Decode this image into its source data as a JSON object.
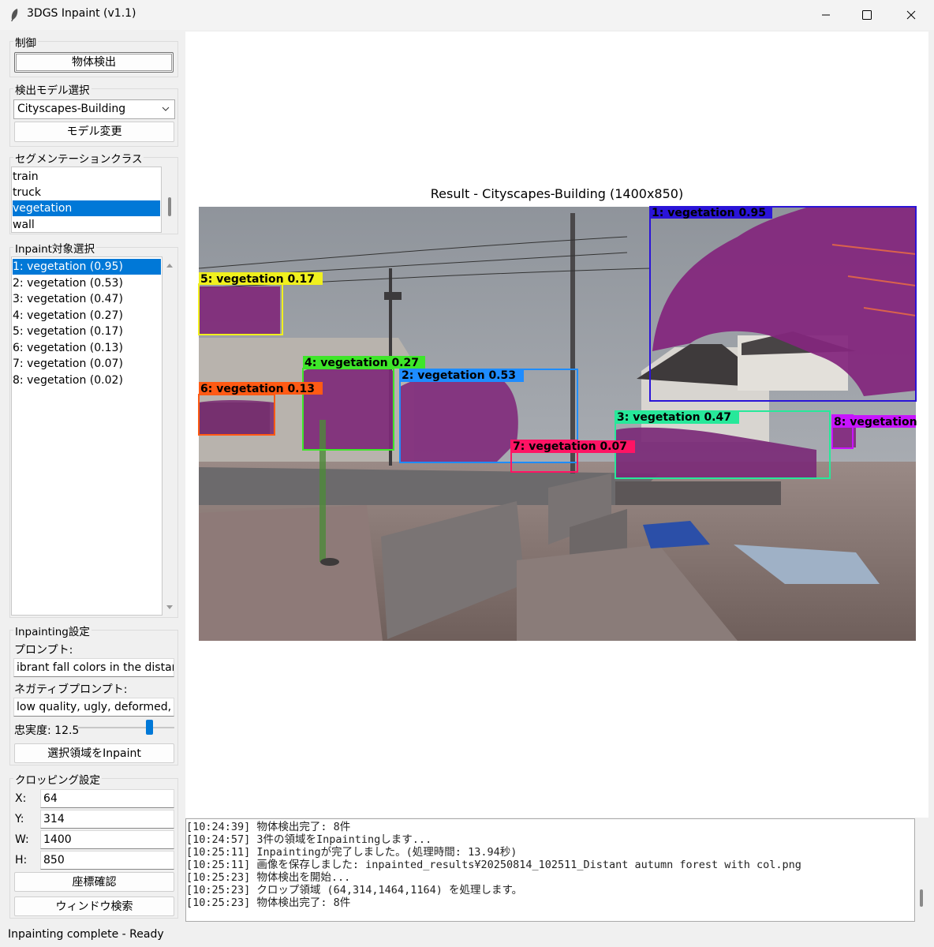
{
  "window": {
    "title": "3DGS Inpaint (v1.1)"
  },
  "control": {
    "group_label": "制御",
    "detect_button": "物体検出"
  },
  "model": {
    "group_label": "検出モデル選択",
    "selected": "Cityscapes-Building",
    "change_button": "モデル変更"
  },
  "segmentation": {
    "group_label": "セグメンテーションクラス",
    "items": [
      "train",
      "truck",
      "vegetation",
      "wall"
    ],
    "selected_index": 2
  },
  "targets": {
    "group_label": "Inpaint対象選択",
    "items": [
      "1: vegetation (0.95)",
      "2: vegetation (0.53)",
      "3: vegetation (0.47)",
      "4: vegetation (0.27)",
      "5: vegetation (0.17)",
      "6: vegetation (0.13)",
      "7: vegetation (0.07)",
      "8: vegetation (0.02)"
    ],
    "selected_index": 0
  },
  "inpainting": {
    "group_label": "Inpainting設定",
    "prompt_label": "プロンプト:",
    "prompt_value": "ibrant fall colors in the distance",
    "negative_label": "ネガティブプロンプト:",
    "negative_value": "low quality, ugly, deformed, text",
    "guidance_label": "忠実度: 12.5",
    "guidance_fraction": 0.74,
    "inpaint_button": "選択領域をInpaint"
  },
  "cropping": {
    "group_label": "クロッピング設定",
    "x_label": "X:",
    "x_value": "64",
    "y_label": "Y:",
    "y_value": "314",
    "w_label": "W:",
    "w_value": "1400",
    "h_label": "H:",
    "h_value": "850",
    "confirm_button": "座標確認",
    "window_search_button": "ウィンドウ検索"
  },
  "result": {
    "title": "Result - Cityscapes-Building (1400x850)",
    "detections": [
      {
        "label": "1: vegetation 0.95",
        "color": "#2a14d8"
      },
      {
        "label": "2: vegetation 0.53",
        "color": "#1e8cff"
      },
      {
        "label": "3: vegetation 0.47",
        "color": "#27e89a"
      },
      {
        "label": "4: vegetation 0.27",
        "color": "#3ee62a"
      },
      {
        "label": "5: vegetation 0.17",
        "color": "#f0f01e"
      },
      {
        "label": "6: vegetation 0.13",
        "color": "#ff5a14"
      },
      {
        "label": "7: vegetation 0.07",
        "color": "#ff1464"
      },
      {
        "label": "8: vegetation",
        "color": "#c814ff"
      }
    ]
  },
  "log": [
    "[10:24:39] 物体検出完了: 8件",
    "[10:24:57] 3件の領域をInpaintingします...",
    "[10:25:11] Inpaintingが完了しました。(処理時間: 13.94秒)",
    "[10:25:11] 画像を保存しました: inpainted_results¥20250814_102511_Distant autumn forest with col.png",
    "[10:25:23] 物体検出を開始...",
    "[10:25:23] クロップ領域 (64,314,1464,1164) を処理します。",
    "[10:25:23] 物体検出完了: 8件"
  ],
  "status": {
    "text": "Inpainting complete - Ready"
  }
}
